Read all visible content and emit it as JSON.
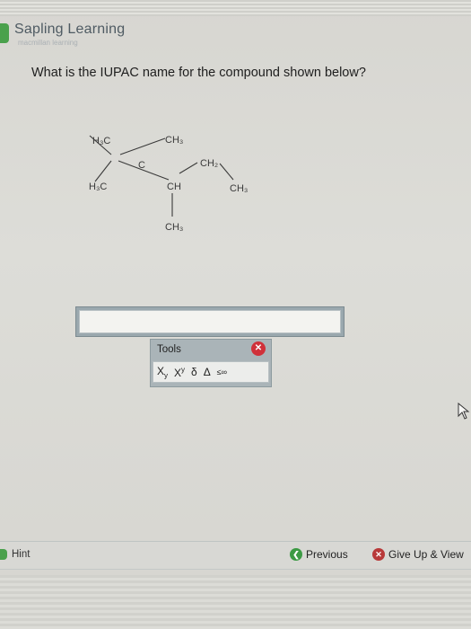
{
  "brand": {
    "name": "Sapling Learning",
    "subtitle": "macmillan learning",
    "accent": "#4aa14c"
  },
  "question": {
    "text": "What is the IUPAC name for the compound shown below?"
  },
  "molecule": {
    "labels": {
      "h3c_top": "H3C",
      "ch3_top": "CH3",
      "c_center": "C",
      "ch2": "CH2",
      "h3c_left": "H3C",
      "ch": "CH",
      "ch3_right": "CH3",
      "ch3_bottom": "CH3"
    }
  },
  "answer": {
    "value": "",
    "placeholder": ""
  },
  "tools": {
    "label": "Tools",
    "buttons": [
      "subscript",
      "superscript",
      "delta-lower",
      "delta-upper",
      "less-equal"
    ]
  },
  "footer": {
    "hint": "Hint",
    "previous": "Previous",
    "give_up": "Give Up & View"
  },
  "colors": {
    "panel": "#aab4b8",
    "prev_icon": "#3c9a44",
    "giveup_icon": "#b83939"
  }
}
